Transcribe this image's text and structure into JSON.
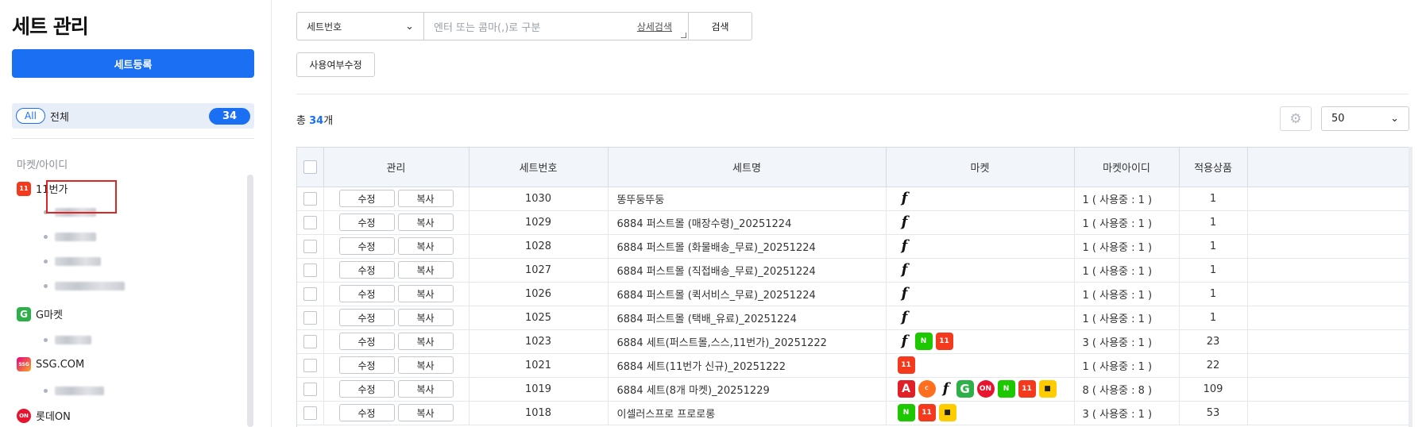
{
  "sidebar": {
    "title": "세트 관리",
    "register_label": "세트등록",
    "all_pill": "All",
    "all_label": "전체",
    "all_count": "34",
    "section_label": "마켓/아이디",
    "markets": [
      {
        "name": "11번가",
        "logo": "11st-logo",
        "color": "#f5391c"
      },
      {
        "name": "G마켓",
        "logo": "gmarket-logo",
        "color": "#2db04a"
      },
      {
        "name": "SSG.COM",
        "logo": "ssg-logo",
        "color": "#e6007e"
      },
      {
        "name": "롯데ON",
        "logo": "lotteon-logo",
        "color": "#e8132e"
      }
    ]
  },
  "search": {
    "type_value": "세트번호",
    "placeholder": "엔터 또는 콤마(,)로 구분",
    "advanced_link": "상세검색",
    "search_button": "검색"
  },
  "toolbar": {
    "use_toggle_button": "사용여부수정",
    "total_prefix": "총 ",
    "total_count": "34",
    "total_suffix": "개",
    "per_page": "50"
  },
  "table": {
    "columns": [
      "관리",
      "세트번호",
      "세트명",
      "마켓",
      "마켓아이디",
      "적용상품"
    ],
    "edit_label": "수정",
    "copy_label": "복사",
    "rows": [
      {
        "no": "1030",
        "name": "똥뚜둥뚜둥",
        "markets": [
          "f"
        ],
        "account": "1 ( 사용중 : 1 )",
        "applied": "1"
      },
      {
        "no": "1029",
        "name": "6884 퍼스트몰 (매장수령)_20251224",
        "markets": [
          "f"
        ],
        "account": "1 ( 사용중 : 1 )",
        "applied": "1"
      },
      {
        "no": "1028",
        "name": "6884 퍼스트몰 (화물배송_무료)_20251224",
        "markets": [
          "f"
        ],
        "account": "1 ( 사용중 : 1 )",
        "applied": "1"
      },
      {
        "no": "1027",
        "name": "6884 퍼스트몰 (직접배송_무료)_20251224",
        "markets": [
          "f"
        ],
        "account": "1 ( 사용중 : 1 )",
        "applied": "1"
      },
      {
        "no": "1026",
        "name": "6884 퍼스트몰 (퀵서비스_무료)_20251224",
        "markets": [
          "f"
        ],
        "account": "1 ( 사용중 : 1 )",
        "applied": "1"
      },
      {
        "no": "1025",
        "name": "6884 퍼스트몰 (택배_유료)_20251224",
        "markets": [
          "f"
        ],
        "account": "1 ( 사용중 : 1 )",
        "applied": "1"
      },
      {
        "no": "1023",
        "name": "6884 세트(퍼스트몰,스스,11번가)_20251222",
        "markets": [
          "f",
          "n",
          "11"
        ],
        "account": "3 ( 사용중 : 1 )",
        "applied": "23"
      },
      {
        "no": "1021",
        "name": "6884 세트(11번가 신규)_20251222",
        "markets": [
          "11"
        ],
        "account": "1 ( 사용중 : 1 )",
        "applied": "22"
      },
      {
        "no": "1019",
        "name": "6884 세트(8개 마켓)_20251229",
        "markets": [
          "a",
          "cp",
          "f",
          "g",
          "on",
          "n",
          "11",
          "y"
        ],
        "account": "8 ( 사용중 : 8 )",
        "applied": "109"
      },
      {
        "no": "1018",
        "name": "이셀러스프로 프로로롱",
        "markets": [
          "n",
          "11",
          "y"
        ],
        "account": "3 ( 사용중 : 1 )",
        "applied": "53"
      }
    ]
  },
  "market_icons": {
    "f": {
      "glyph": "f",
      "icon": "firstmall-icon"
    },
    "n": {
      "glyph": "N",
      "icon": "naver-icon"
    },
    "11": {
      "glyph": "11",
      "icon": "11st-icon"
    },
    "a": {
      "glyph": "A",
      "icon": "auction-icon"
    },
    "cp": {
      "glyph": "C",
      "icon": "coupang-icon"
    },
    "g": {
      "glyph": "G",
      "icon": "gmarket-icon"
    },
    "on": {
      "glyph": "ON",
      "icon": "lotteon-icon"
    },
    "y": {
      "glyph": "■",
      "icon": "yellow-market-icon"
    }
  }
}
